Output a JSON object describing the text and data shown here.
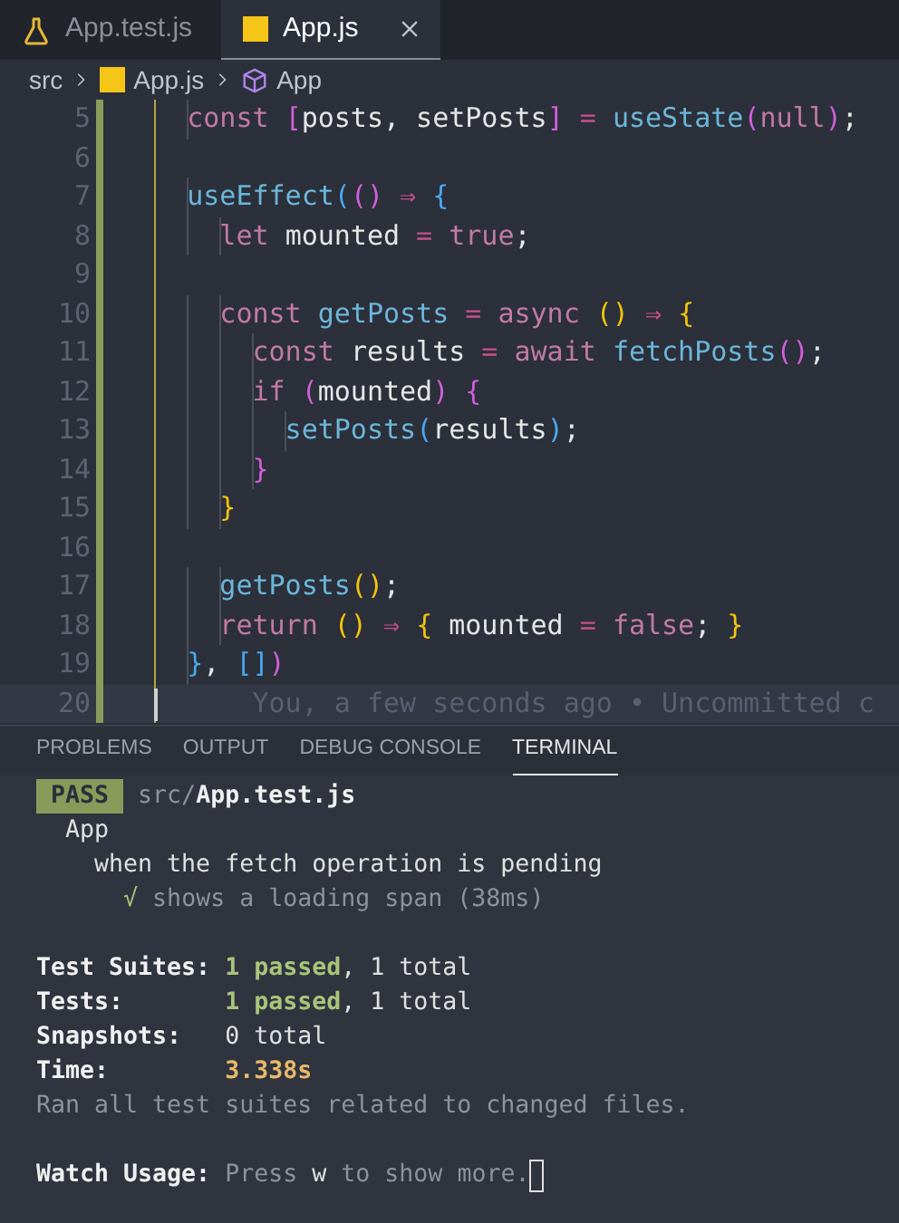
{
  "editor_tabs": [
    {
      "label": "App.test.js",
      "kind": "flask",
      "selected": false
    },
    {
      "label": "App.js",
      "kind": "js",
      "selected": true
    }
  ],
  "breadcrumb": [
    {
      "label": "src"
    },
    {
      "label": "App.js",
      "kind": "js"
    },
    {
      "label": "App",
      "kind": "cube"
    }
  ],
  "code_lines": [
    {
      "number": "5",
      "current": false,
      "tokens": [
        {
          "text": "    const ",
          "kind": "kw"
        },
        {
          "text": "[",
          "kind": "b2"
        },
        {
          "text": "posts, setPosts",
          "kind": "id"
        },
        {
          "text": "]",
          "kind": "b2"
        },
        {
          "text": " = ",
          "kind": "op"
        },
        {
          "text": "useState",
          "kind": "fn"
        },
        {
          "text": "(",
          "kind": "b2"
        },
        {
          "text": "null",
          "kind": "kw"
        },
        {
          "text": ")",
          "kind": "b2"
        },
        {
          "text": ";",
          "kind": "id"
        }
      ]
    },
    {
      "number": "6",
      "current": false
    },
    {
      "number": "7",
      "current": false,
      "tokens": [
        {
          "text": "    useEffect",
          "kind": "fn"
        },
        {
          "text": "(",
          "kind": "b3"
        },
        {
          "text": "()",
          "kind": "b2"
        },
        {
          "text": " ⇒ ",
          "kind": "op"
        },
        {
          "text": "{",
          "kind": "b3"
        }
      ]
    },
    {
      "number": "8",
      "current": false,
      "tokens": [
        {
          "text": "      let ",
          "kind": "kw"
        },
        {
          "text": "mounted",
          "kind": "id"
        },
        {
          "text": " = ",
          "kind": "op"
        },
        {
          "text": "true",
          "kind": "kw"
        },
        {
          "text": ";",
          "kind": "id"
        }
      ]
    },
    {
      "number": "9",
      "current": false
    },
    {
      "number": "10",
      "current": false,
      "tokens": [
        {
          "text": "      const ",
          "kind": "kw"
        },
        {
          "text": "getPosts",
          "kind": "fn"
        },
        {
          "text": " = ",
          "kind": "op"
        },
        {
          "text": "async ",
          "kind": "kw"
        },
        {
          "text": "()",
          "kind": "b1"
        },
        {
          "text": " ⇒ ",
          "kind": "op"
        },
        {
          "text": "{",
          "kind": "b1"
        }
      ]
    },
    {
      "number": "11",
      "current": false,
      "tokens": [
        {
          "text": "        const ",
          "kind": "kw"
        },
        {
          "text": "results",
          "kind": "id"
        },
        {
          "text": " = ",
          "kind": "op"
        },
        {
          "text": "await ",
          "kind": "kw"
        },
        {
          "text": "fetchPosts",
          "kind": "fn"
        },
        {
          "text": "()",
          "kind": "b2"
        },
        {
          "text": ";",
          "kind": "id"
        }
      ]
    },
    {
      "number": "12",
      "current": false,
      "tokens": [
        {
          "text": "        if ",
          "kind": "kw"
        },
        {
          "text": "(",
          "kind": "b2"
        },
        {
          "text": "mounted",
          "kind": "id"
        },
        {
          "text": ")",
          "kind": "b2"
        },
        {
          "text": " {",
          "kind": "b2"
        }
      ]
    },
    {
      "number": "13",
      "current": false,
      "tokens": [
        {
          "text": "          setPosts",
          "kind": "fn"
        },
        {
          "text": "(",
          "kind": "b3"
        },
        {
          "text": "results",
          "kind": "id"
        },
        {
          "text": ")",
          "kind": "b3"
        },
        {
          "text": ";",
          "kind": "id"
        }
      ]
    },
    {
      "number": "14",
      "current": false,
      "tokens": [
        {
          "text": "        }",
          "kind": "b2"
        }
      ]
    },
    {
      "number": "15",
      "current": false,
      "tokens": [
        {
          "text": "      }",
          "kind": "b1"
        }
      ]
    },
    {
      "number": "16",
      "current": false
    },
    {
      "number": "17",
      "current": false,
      "tokens": [
        {
          "text": "      getPosts",
          "kind": "fn"
        },
        {
          "text": "()",
          "kind": "b1"
        },
        {
          "text": ";",
          "kind": "id"
        }
      ]
    },
    {
      "number": "18",
      "current": false,
      "tokens": [
        {
          "text": "      return ",
          "kind": "kw"
        },
        {
          "text": "()",
          "kind": "b1"
        },
        {
          "text": " ⇒ ",
          "kind": "op"
        },
        {
          "text": "{",
          "kind": "b1"
        },
        {
          "text": " mounted",
          "kind": "id"
        },
        {
          "text": " = ",
          "kind": "op"
        },
        {
          "text": "false",
          "kind": "kw"
        },
        {
          "text": ";",
          "kind": "id"
        },
        {
          "text": " }",
          "kind": "b1"
        }
      ]
    },
    {
      "number": "19",
      "current": false,
      "tokens": [
        {
          "text": "    }",
          "kind": "b3"
        },
        {
          "text": ", ",
          "kind": "id"
        },
        {
          "text": "[]",
          "kind": "b3"
        },
        {
          "text": ")",
          "kind": "b2"
        }
      ]
    },
    {
      "number": "20",
      "current": true,
      "blame": "You, a few seconds ago • Uncommitted c"
    }
  ],
  "panel_tabs": [
    {
      "label": "PROBLEMS",
      "selected": false
    },
    {
      "label": "OUTPUT",
      "selected": false
    },
    {
      "label": "DEBUG CONSOLE",
      "selected": false
    },
    {
      "label": "TERMINAL",
      "selected": true
    }
  ],
  "terminal_lines": [
    {
      "spans": [
        {
          "text": "PASS",
          "kind": "badge"
        },
        {
          "text": "src/",
          "kind": "dim"
        },
        {
          "text": "App.test.js",
          "kind": "bold"
        }
      ]
    },
    {
      "spans": [
        {
          "text": "  App",
          "kind": "plain"
        }
      ]
    },
    {
      "spans": [
        {
          "text": "    when the fetch operation is pending",
          "kind": "plain"
        }
      ]
    },
    {
      "spans": [
        {
          "text": "      √",
          "kind": "check"
        },
        {
          "text": " shows a loading span (38ms)",
          "kind": "dim"
        }
      ]
    },
    {
      "spaced": true,
      "spans": [
        {
          "text": "Test Suites: ",
          "kind": "bold"
        },
        {
          "text": "1 passed",
          "kind": "pass"
        },
        {
          "text": ", 1 total",
          "kind": "plain"
        }
      ]
    },
    {
      "spans": [
        {
          "text": "Tests:       ",
          "kind": "bold"
        },
        {
          "text": "1 passed",
          "kind": "pass"
        },
        {
          "text": ", 1 total",
          "kind": "plain"
        }
      ]
    },
    {
      "spans": [
        {
          "text": "Snapshots:   ",
          "kind": "bold"
        },
        {
          "text": "0 total",
          "kind": "plain"
        }
      ]
    },
    {
      "spans": [
        {
          "text": "Time:        ",
          "kind": "bold"
        },
        {
          "text": "3.338s",
          "kind": "time"
        }
      ]
    },
    {
      "spans": [
        {
          "text": "Ran all test suites related to changed files.",
          "kind": "dim"
        }
      ]
    },
    {
      "spaced": true,
      "cursor": true,
      "spans": [
        {
          "text": "Watch Usage: ",
          "kind": "bold"
        },
        {
          "text": "Press ",
          "kind": "dim"
        },
        {
          "text": "w",
          "kind": "plain"
        },
        {
          "text": " to show more.",
          "kind": "dim"
        }
      ]
    }
  ]
}
